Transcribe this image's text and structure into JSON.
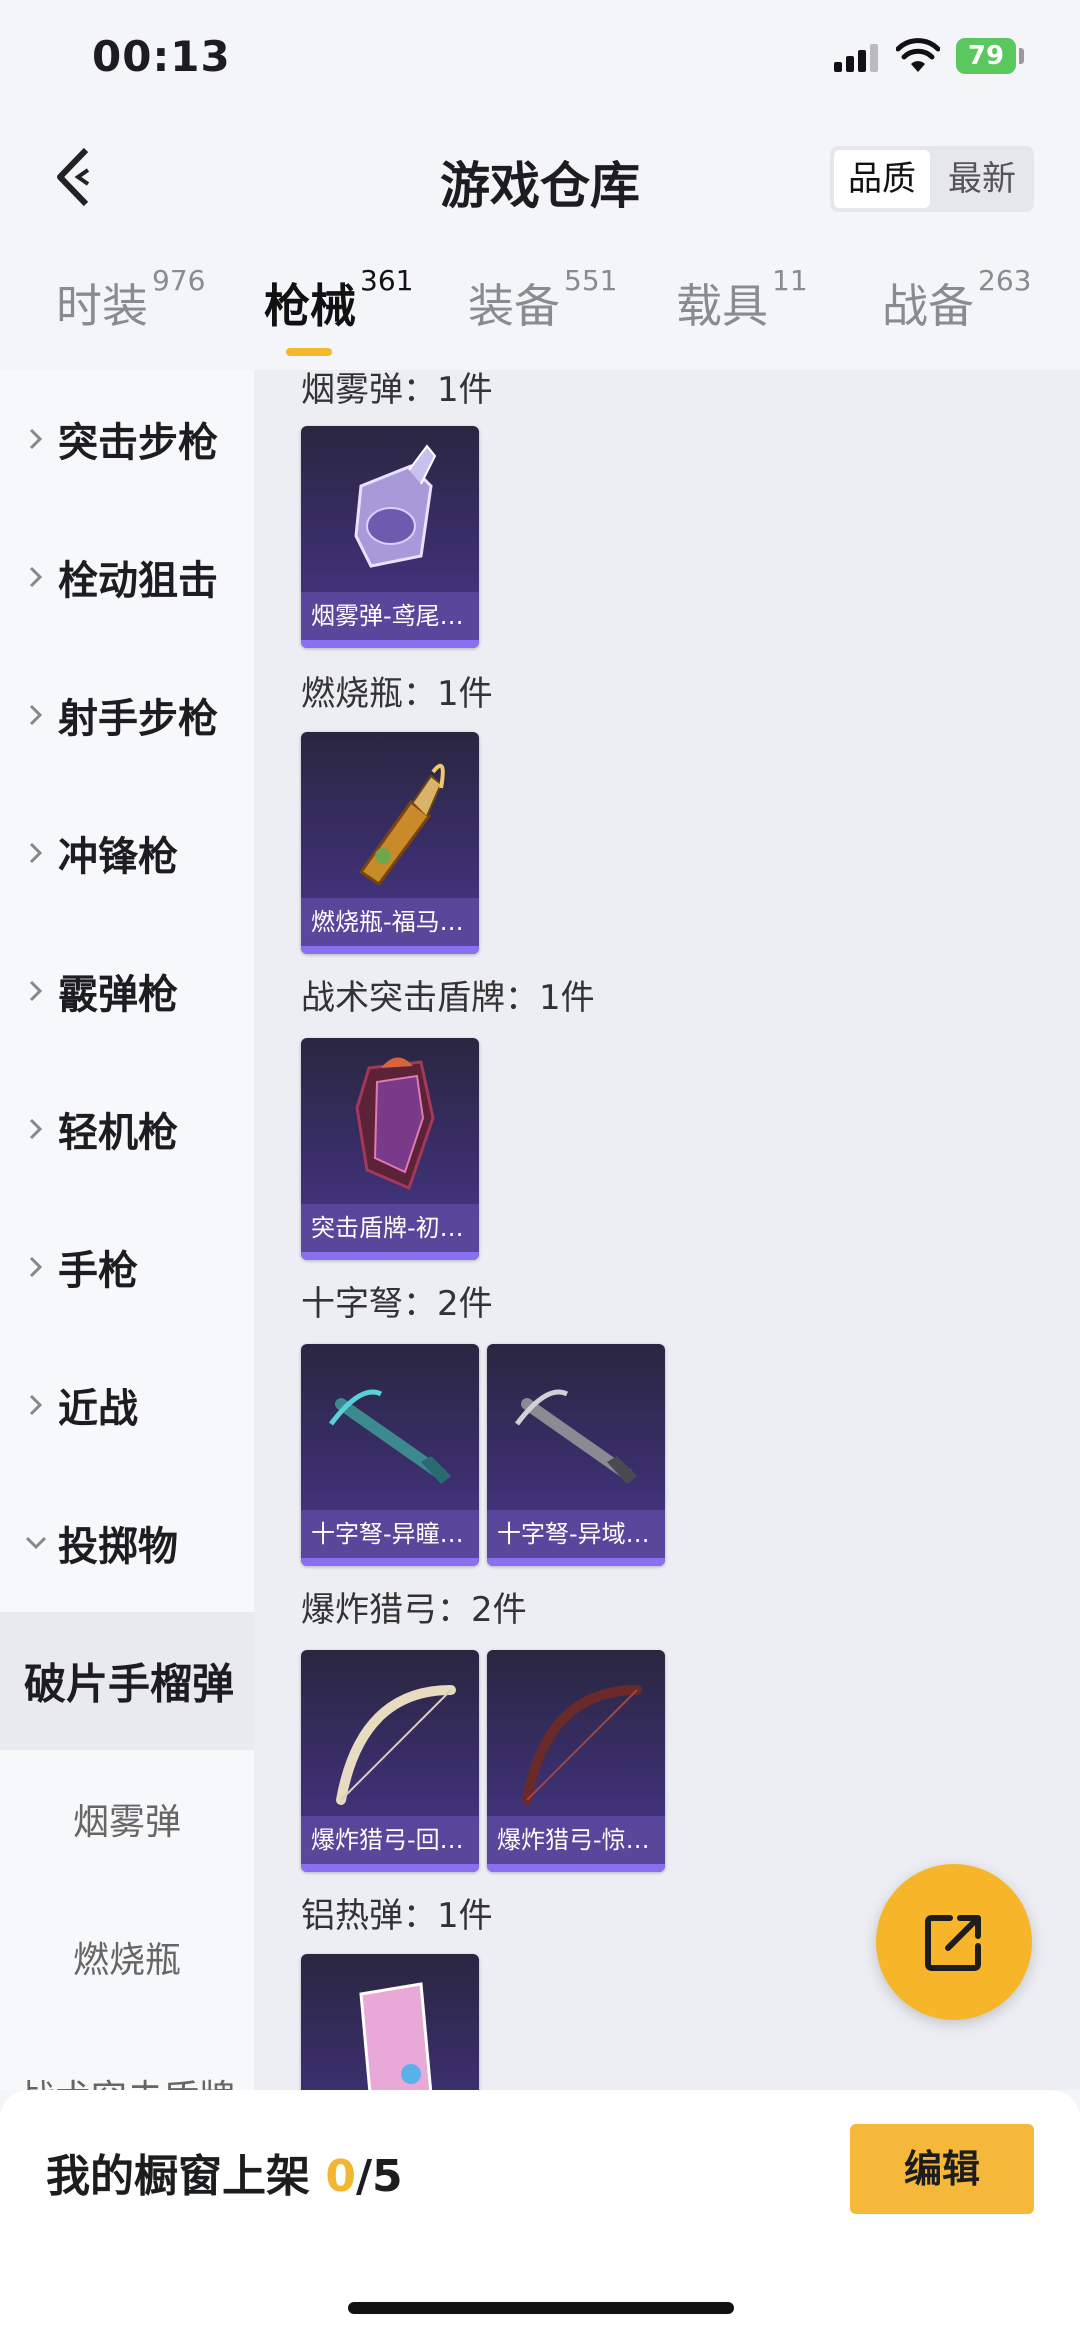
{
  "status": {
    "time": "00:13",
    "battery": "79"
  },
  "header": {
    "title": "游戏仓库",
    "sort_options": [
      "品质",
      "最新"
    ]
  },
  "tabs": [
    {
      "label": "时装",
      "count": "976"
    },
    {
      "label": "枪械",
      "count": "361"
    },
    {
      "label": "装备",
      "count": "551"
    },
    {
      "label": "载具",
      "count": "11"
    },
    {
      "label": "战备",
      "count": "263"
    }
  ],
  "sidebar": {
    "items": [
      "突击步枪",
      "栓动狙击",
      "射手步枪",
      "冲锋枪",
      "霰弹枪",
      "轻机枪",
      "手枪",
      "近战",
      "投掷物"
    ],
    "selected": "破片手榴弹",
    "sub_items": [
      "烟雾弹",
      "燃烧瓶",
      "战术突击盾牌"
    ]
  },
  "groups": [
    {
      "title": "烟雾弹：1件",
      "cards": [
        "烟雾弹-鸢尾…"
      ]
    },
    {
      "title": "燃烧瓶：1件",
      "cards": [
        "燃烧瓶-福马…"
      ]
    },
    {
      "title": "战术突击盾牌：1件",
      "cards": [
        "突击盾牌-初…"
      ]
    },
    {
      "title": "十字弩：2件",
      "cards": [
        "十字弩-异瞳…",
        "十字弩-异域…"
      ]
    },
    {
      "title": "爆炸猎弓：2件",
      "cards": [
        "爆炸猎弓-回…",
        "爆炸猎弓-惊…"
      ]
    },
    {
      "title": "铝热弹：1件",
      "cards": []
    }
  ],
  "footer": {
    "shelf_label": "我的橱窗上架",
    "shelf_count": "0",
    "shelf_total": "/5",
    "edit_label": "编辑"
  },
  "colors": {
    "accent": "#f5b72c",
    "card_label": "#5d4aa0"
  },
  "icons": [
    "back-arrow-icon",
    "chevron-right-icon",
    "chevron-down-icon",
    "share-external-icon",
    "signal-icon",
    "wifi-icon",
    "battery-icon"
  ]
}
